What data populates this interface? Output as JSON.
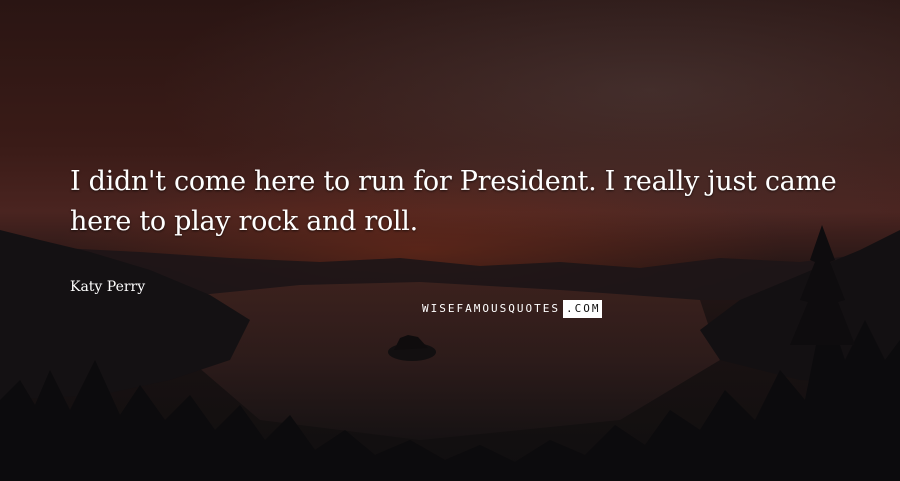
{
  "quote": {
    "text": "I didn't come here to run for President. I really just came here to play rock and roll.",
    "author": "Katy Perry"
  },
  "watermark": {
    "part1": "WISEFAMOUSQUOTES",
    "part2": ".COM"
  },
  "colors": {
    "text": "#ffffff",
    "sky_glow": "#7a2d19",
    "water": "#2a1c1c"
  }
}
